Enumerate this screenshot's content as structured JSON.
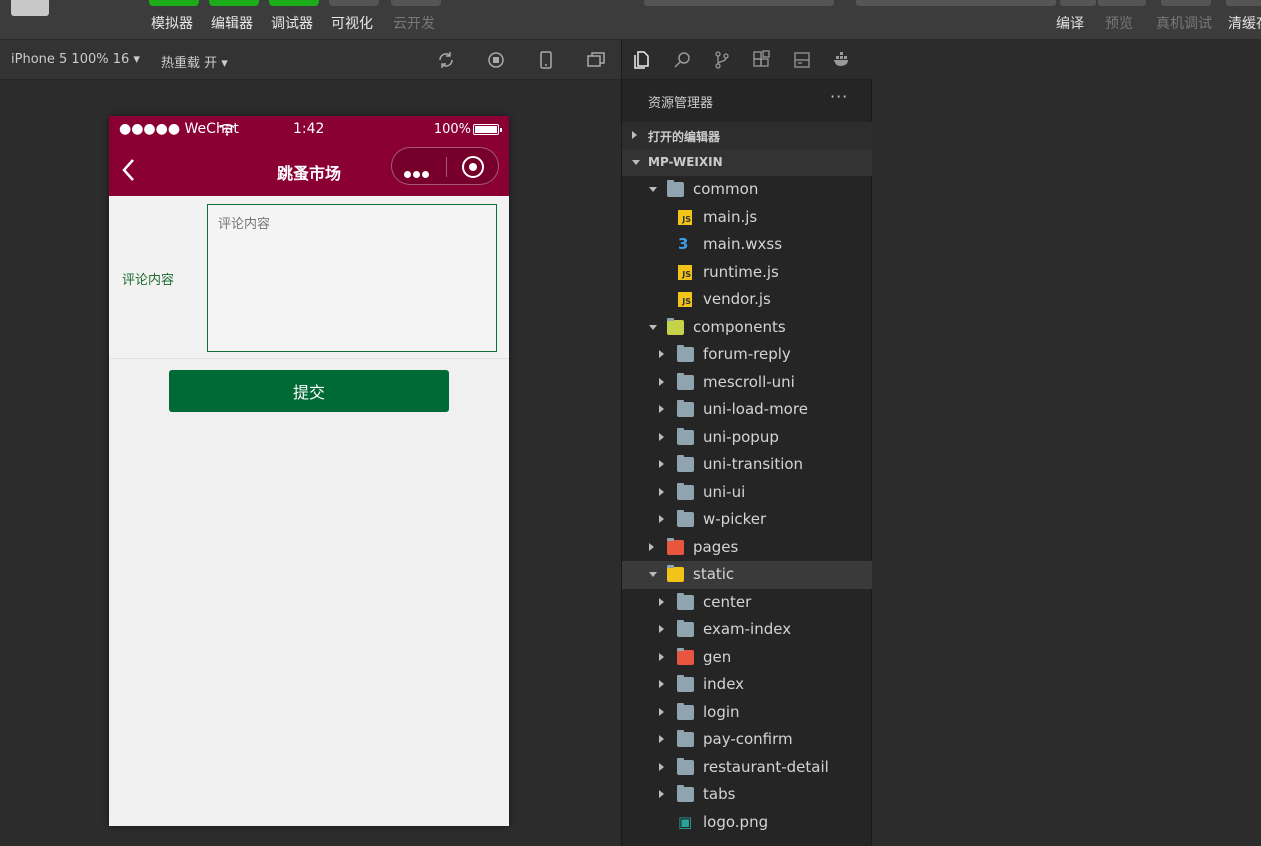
{
  "toolbar": {
    "simulator_label": "模拟器",
    "editor_label": "编辑器",
    "debugger_label": "调试器",
    "visual_label": "可视化",
    "cloud_label": "云开发",
    "compile_label": "编译",
    "preview_label": "预览",
    "device_debug_label": "真机调试",
    "clear_cache_label": "清缓存"
  },
  "simbar": {
    "device_select": "iPhone 5 100% 16 ▾",
    "hot_reload": "热重载 开 ▾"
  },
  "phone": {
    "carrier": "●●●●● WeChat",
    "time": "1:42",
    "battery": "100%",
    "nav_title": "跳蚤市场",
    "form_label": "评论内容",
    "textarea_placeholder": "评论内容",
    "submit_label": "提交",
    "colors": {
      "navbar": "#8b0032",
      "primary": "#006a36"
    }
  },
  "explorer": {
    "title": "资源管理器",
    "more": "···",
    "open_editors": "打开的编辑器",
    "project": "MP-WEIXIN",
    "tree": [
      {
        "name": "common",
        "icon": "folder-open-icon",
        "level": 1,
        "expanded": true
      },
      {
        "name": "main.js",
        "icon": "js-file-icon",
        "level": 2
      },
      {
        "name": "main.wxss",
        "icon": "css-file-icon",
        "level": 2
      },
      {
        "name": "runtime.js",
        "icon": "js-file-icon",
        "level": 2
      },
      {
        "name": "vendor.js",
        "icon": "js-file-icon",
        "level": 2
      },
      {
        "name": "components",
        "icon": "components-folder-icon",
        "level": 1,
        "expanded": true
      },
      {
        "name": "forum-reply",
        "icon": "folder-icon",
        "level": 2
      },
      {
        "name": "mescroll-uni",
        "icon": "folder-icon",
        "level": 2
      },
      {
        "name": "uni-load-more",
        "icon": "folder-icon",
        "level": 2
      },
      {
        "name": "uni-popup",
        "icon": "folder-icon",
        "level": 2
      },
      {
        "name": "uni-transition",
        "icon": "folder-icon",
        "level": 2
      },
      {
        "name": "uni-ui",
        "icon": "folder-icon",
        "level": 2
      },
      {
        "name": "w-picker",
        "icon": "folder-icon",
        "level": 2
      },
      {
        "name": "pages",
        "icon": "pages-folder-icon",
        "level": 1
      },
      {
        "name": "static",
        "icon": "static-folder-icon",
        "level": 1,
        "expanded": true,
        "selected": true
      },
      {
        "name": "center",
        "icon": "folder-icon",
        "level": 2
      },
      {
        "name": "exam-index",
        "icon": "folder-icon",
        "level": 2
      },
      {
        "name": "gen",
        "icon": "gen-folder-icon",
        "level": 2
      },
      {
        "name": "index",
        "icon": "folder-icon",
        "level": 2
      },
      {
        "name": "login",
        "icon": "folder-icon",
        "level": 2
      },
      {
        "name": "pay-confirm",
        "icon": "folder-icon",
        "level": 2
      },
      {
        "name": "restaurant-detail",
        "icon": "folder-icon",
        "level": 2
      },
      {
        "name": "tabs",
        "icon": "folder-icon",
        "level": 2
      },
      {
        "name": "logo.png",
        "icon": "image-file-icon",
        "level": 2
      }
    ]
  }
}
